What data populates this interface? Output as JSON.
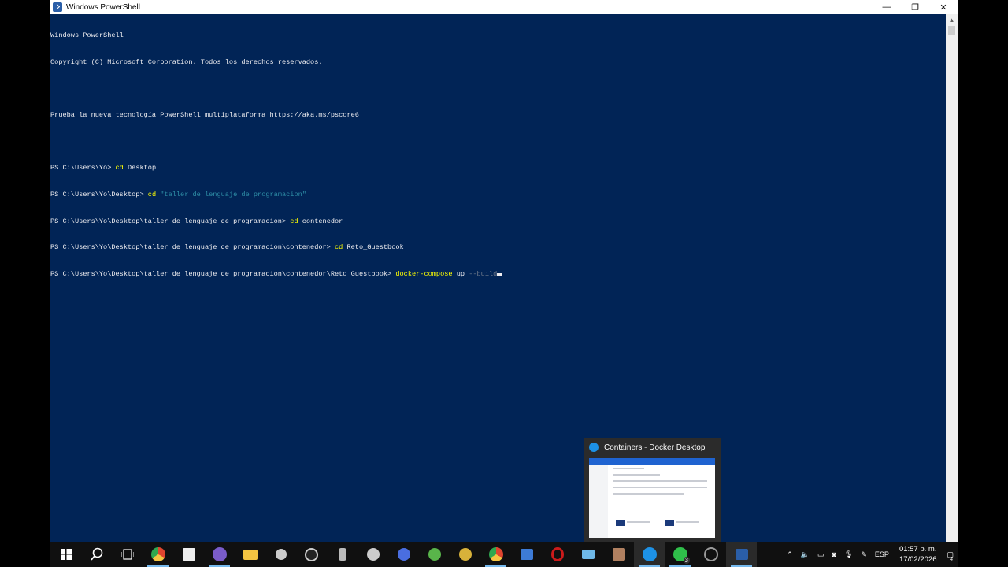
{
  "window": {
    "title": "Windows PowerShell",
    "controls": {
      "minimize": "—",
      "restore": "❐",
      "close": "✕"
    }
  },
  "terminal": {
    "banner": [
      "Windows PowerShell",
      "Copyright (C) Microsoft Corporation. Todos los derechos reservados.",
      "",
      "Prueba la nueva tecnología PowerShell multiplataforma https://aka.ms/pscore6",
      ""
    ],
    "commands": [
      {
        "prompt": "PS C:\\Users\\Yo> ",
        "cmd": "cd",
        "arg": " Desktop",
        "arg_style": "plain"
      },
      {
        "prompt": "PS C:\\Users\\Yo\\Desktop> ",
        "cmd": "cd",
        "arg": " \"taller de lenguaje de programacion\"",
        "arg_style": "str"
      },
      {
        "prompt": "PS C:\\Users\\Yo\\Desktop\\taller de lenguaje de programacion> ",
        "cmd": "cd",
        "arg": " contenedor",
        "arg_style": "plain"
      },
      {
        "prompt": "PS C:\\Users\\Yo\\Desktop\\taller de lenguaje de programacion\\contenedor> ",
        "cmd": "cd",
        "arg": " Reto_Guestbook",
        "arg_style": "plain"
      },
      {
        "prompt": "PS C:\\Users\\Yo\\Desktop\\taller de lenguaje de programacion\\contenedor\\Reto_Guestbook> ",
        "cmd": "docker-compose",
        "arg": " up",
        "arg2": " --build",
        "arg_style": "plain"
      }
    ]
  },
  "taskbar": {
    "icons": [
      {
        "name": "start-icon",
        "color": "#ffffff"
      },
      {
        "name": "search-icon",
        "color": "#ffffff"
      },
      {
        "name": "task-view-icon",
        "color": "#ffffff"
      },
      {
        "name": "chrome-icon",
        "color": "#e0452f"
      },
      {
        "name": "terminal-app-icon",
        "color": "#dddddd"
      },
      {
        "name": "chat-app-icon",
        "color": "#7a5cc9"
      },
      {
        "name": "file-explorer-icon",
        "color": "#f5c542"
      },
      {
        "name": "app-icon-1",
        "color": "#cccccc"
      },
      {
        "name": "app-icon-2",
        "color": "#cccccc"
      },
      {
        "name": "app-icon-3",
        "color": "#bbbbbb"
      },
      {
        "name": "app-icon-4",
        "color": "#cccccc"
      },
      {
        "name": "app-icon-5",
        "color": "#4a6ee0"
      },
      {
        "name": "app-icon-6",
        "color": "#59b54a"
      },
      {
        "name": "app-icon-7",
        "color": "#d8b23a"
      },
      {
        "name": "chrome-icon-2",
        "color": "#e0452f"
      },
      {
        "name": "app-icon-8",
        "color": "#3d7bd6"
      },
      {
        "name": "opera-icon",
        "color": "#cc1b1b"
      },
      {
        "name": "app-icon-9",
        "color": "#6fb8e8"
      },
      {
        "name": "app-icon-10",
        "color": "#b08060"
      },
      {
        "name": "docker-icon",
        "color": "#1d91e6"
      },
      {
        "name": "whatsapp-icon",
        "color": "#2fbf4a"
      },
      {
        "name": "app-icon-11",
        "color": "#999999"
      },
      {
        "name": "powershell-icon",
        "color": "#2a5ea8"
      }
    ],
    "whatsapp_badge": "3",
    "tray": {
      "lang": "ESP",
      "time": "01:57 p. m.",
      "date": "17/02/2026",
      "notif_count": "4"
    }
  },
  "thumbnail": {
    "title": "Containers - Docker Desktop"
  }
}
